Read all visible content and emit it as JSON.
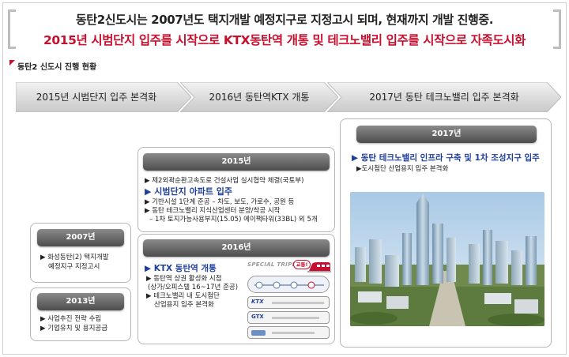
{
  "header": {
    "line1": "동탄2신도시는 2007년도 택지개발 예정지구로 지정고시 되며, 현재까지 개발 진행중.",
    "line2": "2015년 시범단지 입주를 시작으로 KTX동탄역 개통 및 테크노밸리 입주를 시작으로 자족도시화"
  },
  "subtitle": "동탄2 신도시 진행 현황",
  "timeline": [
    "2015년 시범단지 입주 본격화",
    "2016년 동탄역KTX 개통",
    "2017년 동탄 테크노밸리 입주 본격화"
  ],
  "box2007": {
    "year": "2007년",
    "items": [
      "▶ 화성동탄(2) 택지개발",
      "예정지구 지정고시"
    ]
  },
  "box2013": {
    "year": "2013년",
    "items": [
      "▶ 사업추진 전략 수립",
      "▶ 기업유치 및 용지공급"
    ]
  },
  "box2015": {
    "year": "2015년",
    "items": [
      "▶ 제2외곽순환고속도로 건설사업 실시협약 체결(국토부)",
      "▶ 기반시설 1단계 준공 – 차도, 보도, 가로수, 공원 등",
      "▶ 동탄 테크노밸리 지식산업센터 분양/착공 시작",
      "– 1차 토지가능사용부지(15.05) 에이팩타워(33BL) 외 5개"
    ],
    "highlight": "▶ 시범단지 아파트 입주"
  },
  "box2016": {
    "year": "2016년",
    "highlight": "▶ KTX 동탄역 개통",
    "items": [
      "▶ 동탄역 상권 활성화 시점",
      "(상가/오피스텔  16~17년 준공)",
      "▶ 테크노밸리 내 도시첨단",
      "산업용지 입주 본격화"
    ],
    "special": "SPECIAL TRIPLE",
    "special_badge": "교통!",
    "rows": [
      "KTX",
      "GTX"
    ]
  },
  "box2017": {
    "year": "2017년",
    "highlight": "▶ 동탄 테크노밸리 인프라 구축 및 1차 조성지구 입주",
    "item": "▶도시첨단 산업용지 입주 본격화"
  },
  "colors": {
    "accent": "#c8102e",
    "blue": "#1f3f9c",
    "pill": "#5a5a5a"
  }
}
